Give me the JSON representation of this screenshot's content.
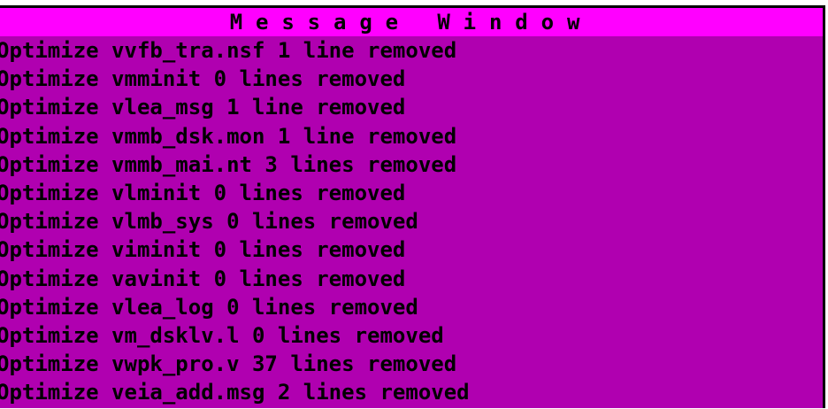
{
  "window": {
    "title": "Message Window",
    "colors": {
      "title_bar": "#ff00ff",
      "body": "#b000b0",
      "text": "#000000"
    }
  },
  "messages": [
    "Optimize vvfb_tra.nsf 1 line removed",
    "Optimize vmminit 0 lines removed",
    "Optimize vlea_msg 1 line removed",
    "Optimize vmmb_dsk.mon 1 line removed",
    "Optimize vmmb_mai.nt 3 lines removed",
    "Optimize vlminit 0 lines removed",
    "Optimize vlmb_sys 0 lines removed",
    "Optimize viminit 0 lines removed",
    "Optimize vavinit 0 lines removed",
    "Optimize vlea_log 0 lines removed",
    "Optimize vm_dsklv.l 0 lines removed",
    "Optimize vwpk_pro.v 37 lines removed",
    "Optimize veia_add.msg 2 lines removed"
  ]
}
